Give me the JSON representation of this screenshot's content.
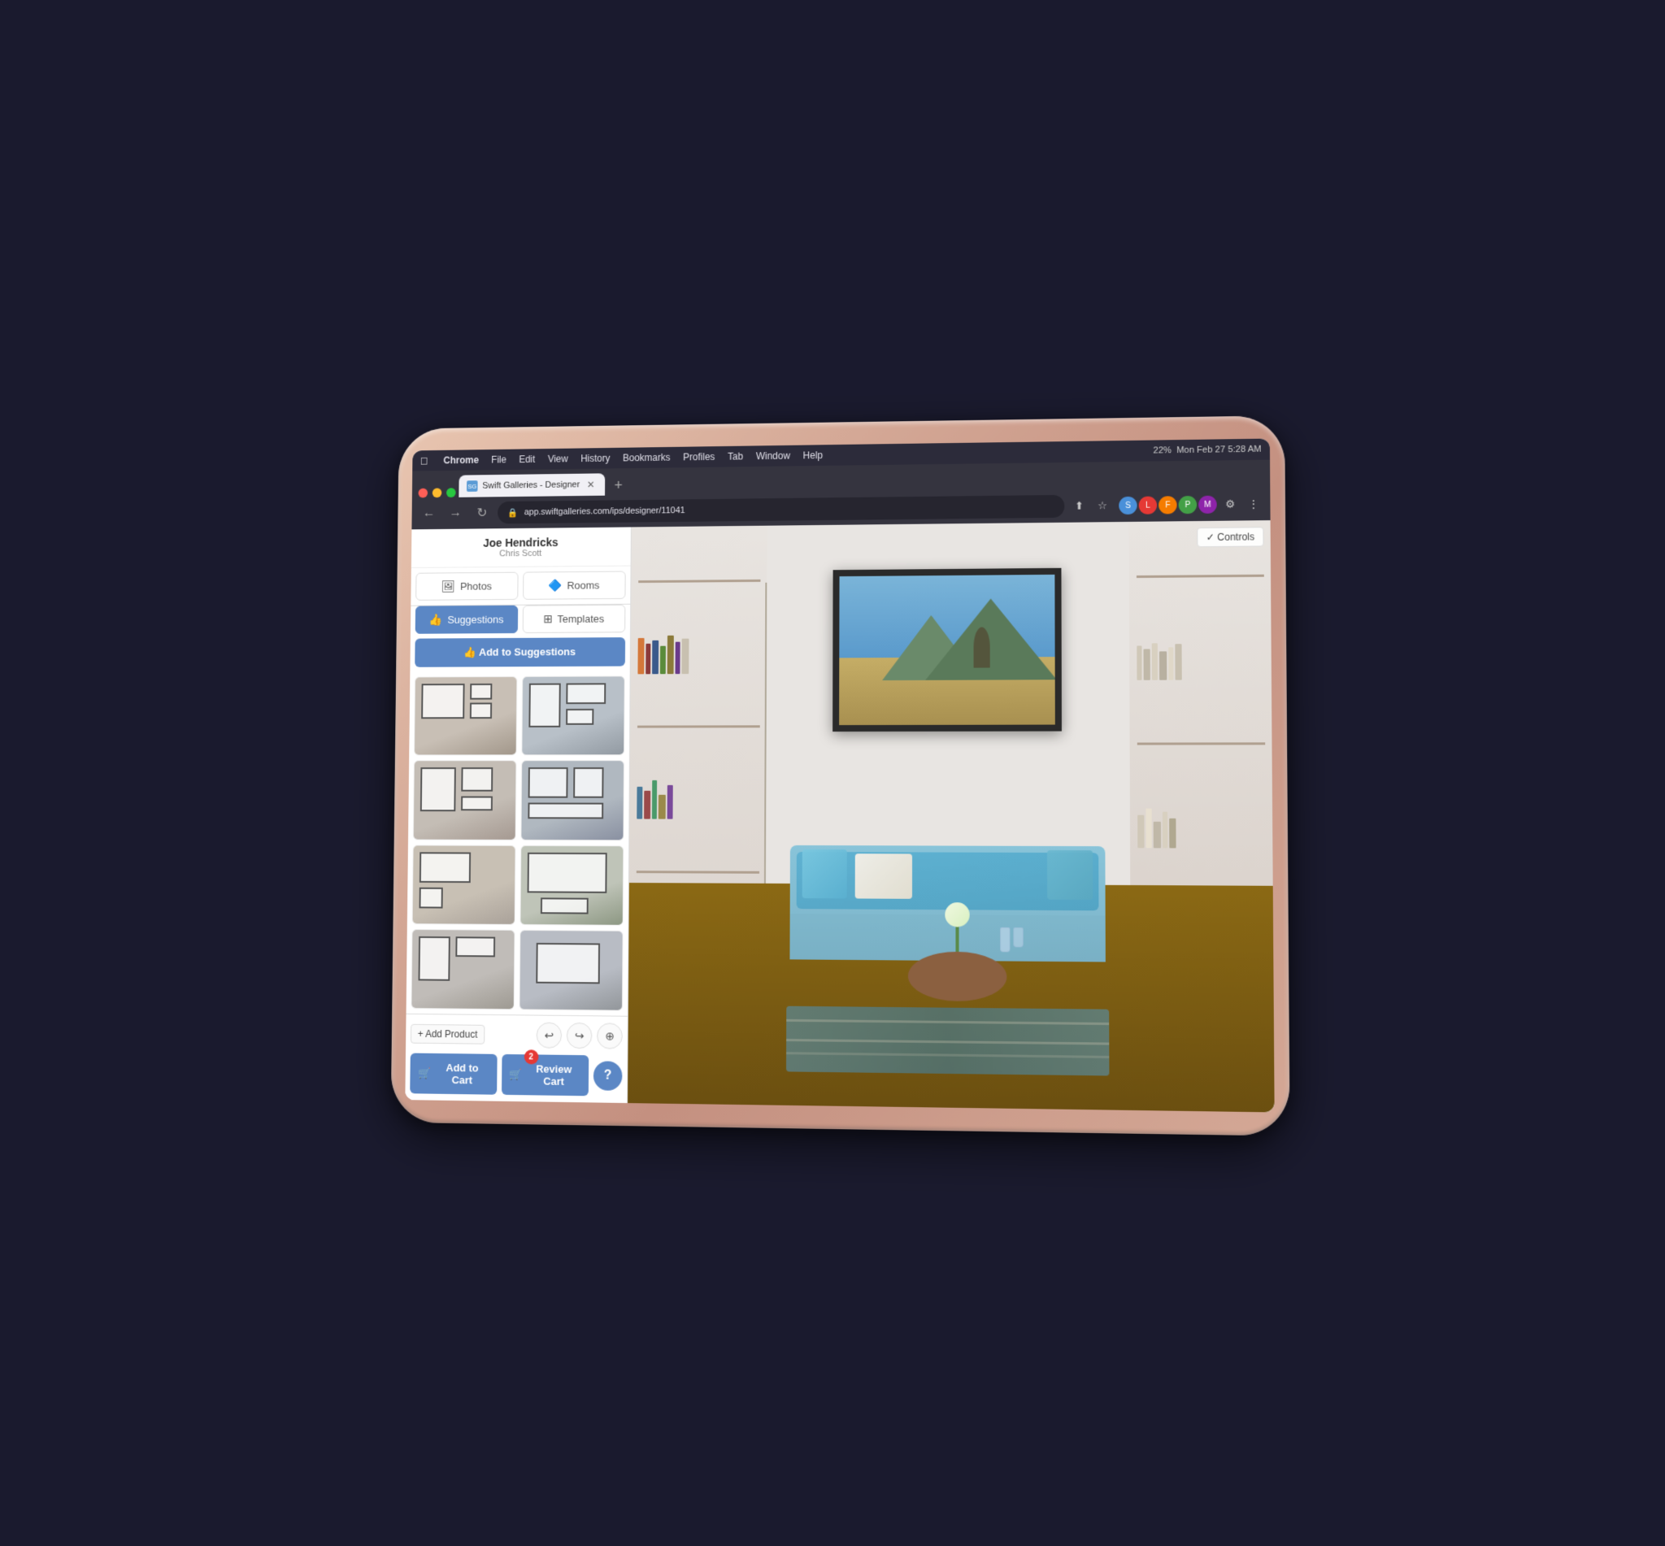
{
  "mac": {
    "apple_icon": "⌘",
    "menu_items": [
      "Chrome",
      "File",
      "Edit",
      "View",
      "History",
      "Bookmarks",
      "Profiles",
      "Tab",
      "Window",
      "Help"
    ],
    "status": "Mon Feb 27  5:28 AM",
    "battery": "22%"
  },
  "browser": {
    "tab_title": "Swift Galleries - Designer",
    "tab_favicon": "SG",
    "url": "app.swiftgalleries.com/ips/designer/11041",
    "new_tab_icon": "+",
    "nav": {
      "back": "←",
      "forward": "→",
      "refresh": "↻"
    }
  },
  "sidebar": {
    "user_name": "Joe Hendricks",
    "user_sub": "Chris Scott",
    "tabs": {
      "photos": "Photos",
      "rooms": "Rooms",
      "suggestions": "Suggestions",
      "templates": "Templates"
    },
    "add_suggestions_label": "👍 Add to Suggestions",
    "gallery_items": [
      {
        "id": 1,
        "style": "style1"
      },
      {
        "id": 2,
        "style": "style2"
      },
      {
        "id": 3,
        "style": "style3"
      },
      {
        "id": 4,
        "style": "style4"
      },
      {
        "id": 5,
        "style": "style5"
      },
      {
        "id": 6,
        "style": "style6"
      },
      {
        "id": 7,
        "style": "style7"
      },
      {
        "id": 8,
        "style": "style8"
      }
    ]
  },
  "bottom_bar": {
    "add_product_label": "+ Add Product",
    "undo_icon": "↩",
    "redo_icon": "↪",
    "zoom_icon": "🔍",
    "add_cart_label": "Add to Cart",
    "review_cart_label": "Review Cart",
    "cart_badge": "2",
    "help_label": "?",
    "cart_icon": "🛒",
    "review_cart_icon": "🛒"
  },
  "main": {
    "controls_label": "✓ Controls"
  }
}
